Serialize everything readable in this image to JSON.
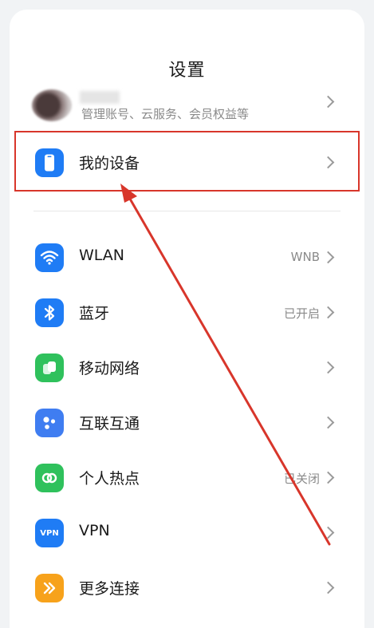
{
  "header": {
    "title": "设置"
  },
  "account": {
    "subtitle": "管理账号、云服务、会员权益等"
  },
  "my_device": {
    "label": "我的设备"
  },
  "items": [
    {
      "label": "WLAN",
      "value": "WNB"
    },
    {
      "label": "蓝牙",
      "value": "已开启"
    },
    {
      "label": "移动网络",
      "value": ""
    },
    {
      "label": "互联互通",
      "value": ""
    },
    {
      "label": "个人热点",
      "value": "已关闭"
    },
    {
      "label": "VPN",
      "value": ""
    },
    {
      "label": "更多连接",
      "value": ""
    }
  ],
  "icons": {
    "my_device": "phone-icon",
    "wlan": "wifi-icon",
    "bluetooth": "bluetooth-icon",
    "mobile": "mobile-network-icon",
    "interconnect": "interconnect-icon",
    "hotspot": "hotspot-icon",
    "vpn": "vpn-icon",
    "more": "more-connections-icon"
  },
  "vpn_icon_text": "VPN",
  "colors": {
    "blue": "#1f7cf5",
    "green": "#2fc15c",
    "orange": "#f7a21b",
    "annotation_red": "#d8362b"
  }
}
